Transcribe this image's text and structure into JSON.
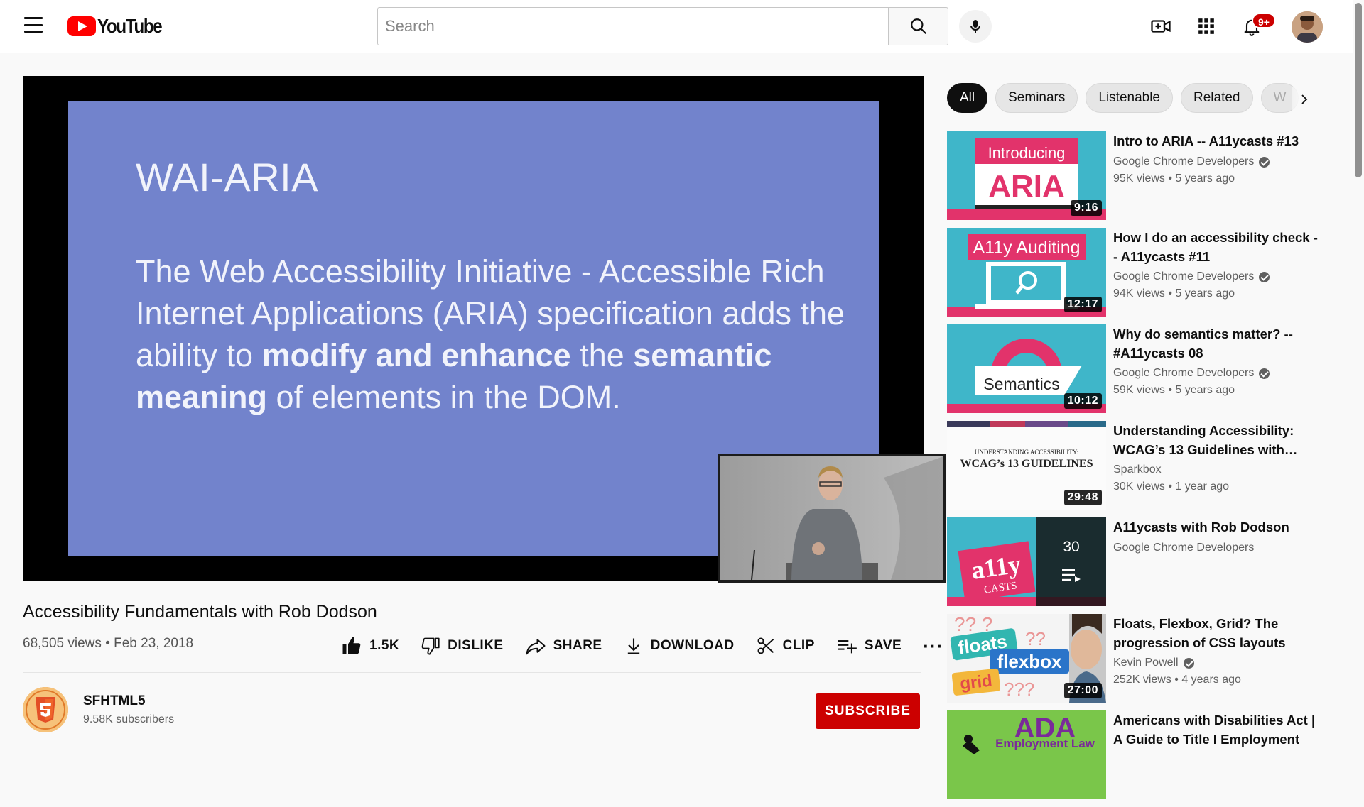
{
  "header": {
    "logo_text": "YouTube",
    "search_placeholder": "Search",
    "notification_count": "9+"
  },
  "player": {
    "slide_title": "WAI-ARIA",
    "slide_text_1": "The Web Accessibility Initiative - Accessible Rich Internet Applications (ARIA) specification adds the ability to ",
    "slide_bold_1": "modify and enhance",
    "slide_text_2": " the ",
    "slide_bold_2": "semantic meaning",
    "slide_text_3": " of elements in the DOM."
  },
  "video": {
    "title": "Accessibility Fundamentals with Rob Dodson",
    "views": "68,505 views",
    "date": "Feb 23, 2018",
    "meta_separator": "•"
  },
  "actions": {
    "like_count": "1.5K",
    "dislike_label": "DISLIKE",
    "share_label": "SHARE",
    "download_label": "DOWNLOAD",
    "clip_label": "CLIP",
    "save_label": "SAVE"
  },
  "channel": {
    "name": "SFHTML5",
    "subscribers": "9.58K subscribers",
    "subscribe_label": "SUBSCRIBE"
  },
  "chips": [
    "All",
    "Seminars",
    "Listenable",
    "Related",
    "W"
  ],
  "recommendations": [
    {
      "title": "Intro to ARIA -- A11ycasts #13",
      "channel": "Google Chrome Developers",
      "verified": true,
      "stats": "95K views • 5 years ago",
      "duration": "9:16",
      "thumb_text_top": "Introducing",
      "thumb_text_main": "ARIA"
    },
    {
      "title": "How I do an accessibility check -- A11ycasts #11",
      "channel": "Google Chrome Developers",
      "verified": true,
      "stats": "94K views • 5 years ago",
      "duration": "12:17",
      "thumb_text_top": "A11y Auditing"
    },
    {
      "title": "Why do semantics matter? -- #A11ycasts 08",
      "channel": "Google Chrome Developers",
      "verified": true,
      "stats": "59K views • 5 years ago",
      "duration": "10:12",
      "thumb_text_main": "Semantics"
    },
    {
      "title": "Understanding Accessibility: WCAG’s 13 Guidelines with…",
      "channel": "Sparkbox",
      "verified": false,
      "stats": "30K views • 1 year ago",
      "duration": "29:48",
      "thumb_text_top": "UNDERSTANDING ACCESSIBILITY:",
      "thumb_text_main": "WCAG’s 13 GUIDELINES"
    },
    {
      "title": "A11ycasts with Rob Dodson",
      "channel": "Google Chrome Developers",
      "verified": false,
      "playlist_count": "30",
      "thumb_text_main": "a11y",
      "thumb_text_sub": "CASTS"
    },
    {
      "title": "Floats, Flexbox, Grid? The progression of CSS layouts",
      "channel": "Kevin Powell",
      "verified": true,
      "stats": "252K views • 4 years ago",
      "duration": "27:00",
      "thumb_words": [
        "floats",
        "flexbox",
        "grid"
      ]
    },
    {
      "title": "Americans with Disabilities Act | A Guide to Title I Employment",
      "thumb_text_main": "ADA",
      "thumb_text_sub": "Employment Law"
    }
  ],
  "colors": {
    "brand_red": "#ff0000",
    "subscribe_red": "#cc0000",
    "slide_blue": "#7283cc",
    "a11y_pink": "#e2336b",
    "a11y_teal": "#3fb6c9"
  },
  "icons": [
    "menu-icon",
    "search-icon",
    "mic-icon",
    "create-video-icon",
    "apps-icon",
    "bell-icon",
    "thumbs-up-icon",
    "thumbs-down-icon",
    "share-icon",
    "download-icon",
    "scissors-icon",
    "save-playlist-icon",
    "more-icon",
    "chevron-right-icon",
    "verified-icon",
    "playlist-icon"
  ]
}
